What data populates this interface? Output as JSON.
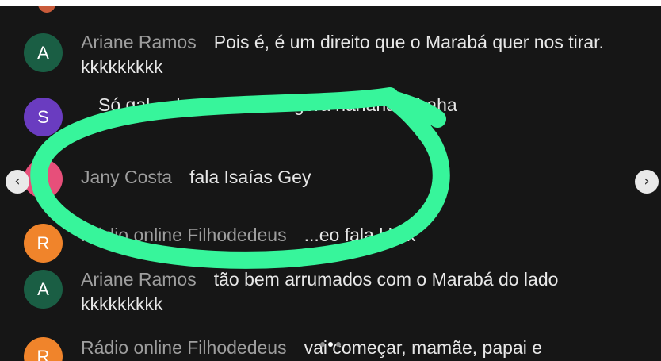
{
  "colors": {
    "chat_background": "#161616",
    "author_text": "#9e9e9e",
    "message_text": "#e8e8e8",
    "annotation_stroke": "#37f59b",
    "avatar_green": "#1a5e44",
    "avatar_purple": "#6a3cc0",
    "avatar_pink": "#e74f7a",
    "avatar_orange": "#f0842b"
  },
  "messages": [
    {
      "initial": "A",
      "author": "Ariane Ramos",
      "text": "Pois é, é um direito que o Marabá quer nos tirar. kkkkkkkkk",
      "avatar_color": "#1a5e44"
    },
    {
      "initial": "S",
      "author": "",
      "text": "Só gal... dar boa tarde agora hahahahahaha",
      "avatar_color": "#6a3cc0"
    },
    {
      "initial": "J",
      "author": "Jany Costa",
      "text": "fala Isaías Gey",
      "avatar_color": "#e74f7a"
    },
    {
      "initial": "R",
      "author": "Rádio online Filhodedeus",
      "text": "...eo fala kkkk",
      "avatar_color": "#f0842b"
    },
    {
      "initial": "A",
      "author": "Ariane Ramos",
      "text": "tão bem arrumados com o Marabá do lado kkkkkkkkk",
      "avatar_color": "#1a5e44"
    },
    {
      "initial": "R",
      "author": "Rádio online Filhodedeus",
      "text": "vai começar, mamãe, papai e",
      "avatar_color": "#f0842b"
    }
  ],
  "carousel": {
    "prev_icon": "chevron-left-icon",
    "next_icon": "chevron-right-icon",
    "prev_glyph": "‹",
    "next_glyph": "›",
    "page_count": 3,
    "active_page": 2
  },
  "annotation": {
    "shape": "hand-drawn ellipse around the Jany Costa message"
  }
}
